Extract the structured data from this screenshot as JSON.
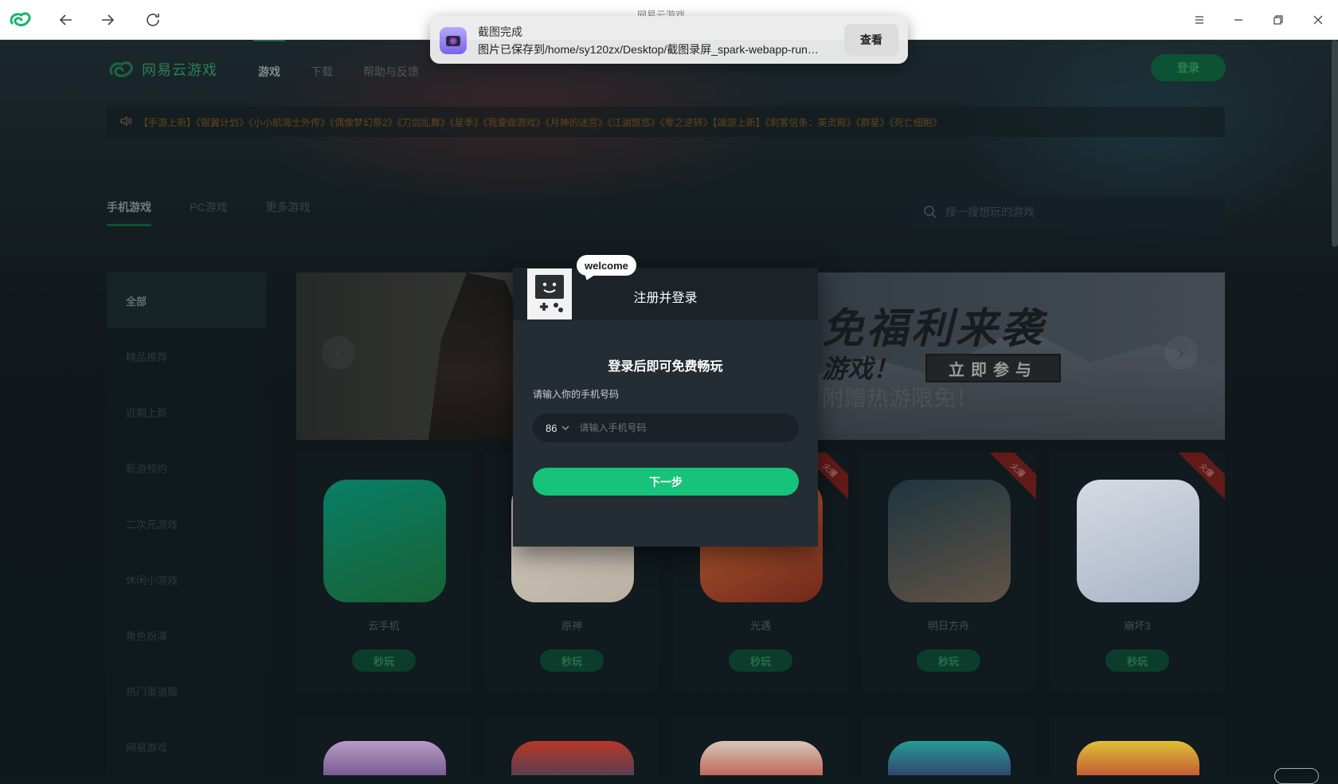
{
  "browser": {
    "page_title": "网易云游戏",
    "icons": [
      "app-logo-icon",
      "back-icon",
      "forward-icon",
      "reload-icon",
      "menu-icon",
      "minimize-icon",
      "restore-icon",
      "close-icon"
    ]
  },
  "toast": {
    "title": "截图完成",
    "body": "图片已保存到/home/sy120zx/Desktop/截图录屏_spark-webapp-run…",
    "button": "查看"
  },
  "site": {
    "logo_text": "网易云游戏",
    "nav": [
      "游戏",
      "下载",
      "帮助与反馈"
    ],
    "login_label": "登录",
    "ticker": "【手游上新】《银翼计划》《小小航海士外传》《偶像梦幻祭2》《刀剑乱舞》《星季》《我要做游戏》《月神的迷宫》《江湖悠悠》《零之逆转》【端游上新】《刺客信条：英灵殿》《群星》《死亡细胞》",
    "tabs": [
      "手机游戏",
      "PC游戏",
      "更多游戏"
    ],
    "search_placeholder": "搜一搜想玩的游戏"
  },
  "sidebar": {
    "items": [
      "全部",
      "精品推荐",
      "近期上新",
      "新游预约",
      "二次元游戏",
      "休闲小游戏",
      "角色扮演",
      "热门渠道服",
      "网易游戏"
    ]
  },
  "banner": {
    "headline": "免福利来袭",
    "headline2": "游戏！",
    "join_label": "立即参与",
    "sub": "附赠热游限免！"
  },
  "games": [
    {
      "name": "云手机",
      "play": "秒玩",
      "hot": false,
      "color1": "#0a8a6e",
      "color2": "#1a6a3a"
    },
    {
      "name": "原神",
      "play": "秒玩",
      "hot": false,
      "color1": "#e8e1d8",
      "color2": "#cbbfb0"
    },
    {
      "name": "光遇",
      "play": "秒玩",
      "hot": true,
      "color1": "#d9743a",
      "color2": "#7a2c1e"
    },
    {
      "name": "明日方舟",
      "play": "秒玩",
      "hot": true,
      "color1": "#1f3a44",
      "color2": "#6a5a4c"
    },
    {
      "name": "崩坏3",
      "play": "秒玩",
      "hot": true,
      "color1": "#e8eef6",
      "color2": "#b7c4d8"
    }
  ],
  "hot_label": "火爆",
  "modal": {
    "welcome": "welcome",
    "title": "注册并登录",
    "heading": "登录后即可免费畅玩",
    "phone_label": "请输入你的手机号码",
    "country_code": "86",
    "phone_placeholder": "请输入手机号码",
    "next_label": "下一步"
  },
  "colors": {
    "accent": "#17c27b",
    "modal_bg": "#232d33",
    "hot": "#6a1e1b"
  }
}
